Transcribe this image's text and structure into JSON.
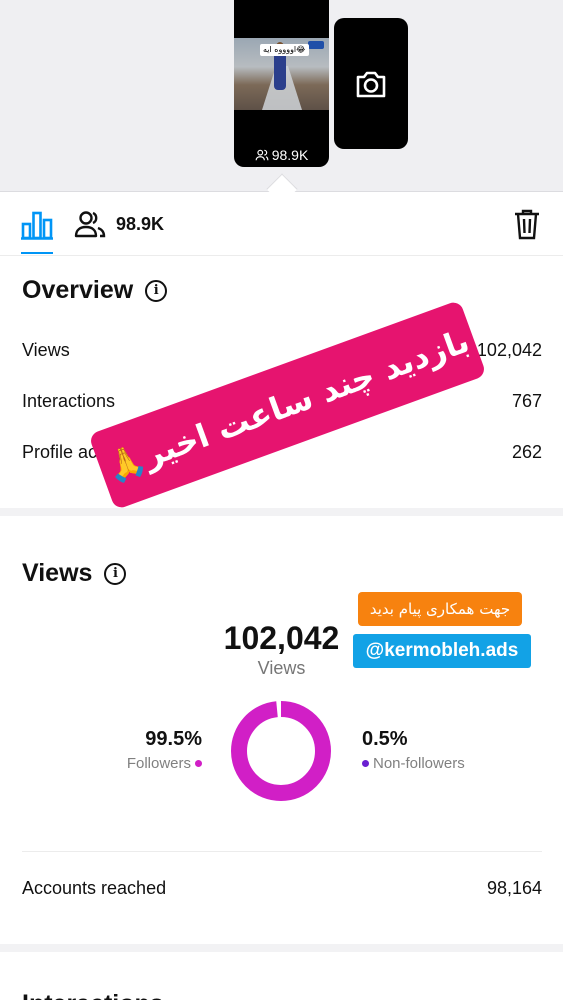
{
  "preview": {
    "thumbnail_caption": "اووووه ایه😂",
    "thumbnail_views": "98.9K"
  },
  "tabs": {
    "audience_count": "98.9K"
  },
  "overview": {
    "title": "Overview",
    "rows": [
      {
        "label": "Views",
        "value": "102,042"
      },
      {
        "label": "Interactions",
        "value": "767"
      },
      {
        "label": "Profile activity",
        "value": "262"
      }
    ]
  },
  "overlay": {
    "banner_text": "بازدید چند ساعت اخیر🙏",
    "contact_text": "جهت همکاری پیام بدید",
    "handle_text": "@kermobleh.ads"
  },
  "views": {
    "title": "Views",
    "total": "102,042",
    "total_label": "Views",
    "followers_pct": "99.5%",
    "followers_label": "Followers",
    "nonfollowers_pct": "0.5%",
    "nonfollowers_label": "Non-followers",
    "followers_fraction": 0.995,
    "followers_color": "#d11fc6",
    "nonfollowers_color": "#6a1fd1",
    "accounts_reached_label": "Accounts reached",
    "accounts_reached_value": "98,164"
  },
  "next_section": {
    "title": "Interactions"
  }
}
